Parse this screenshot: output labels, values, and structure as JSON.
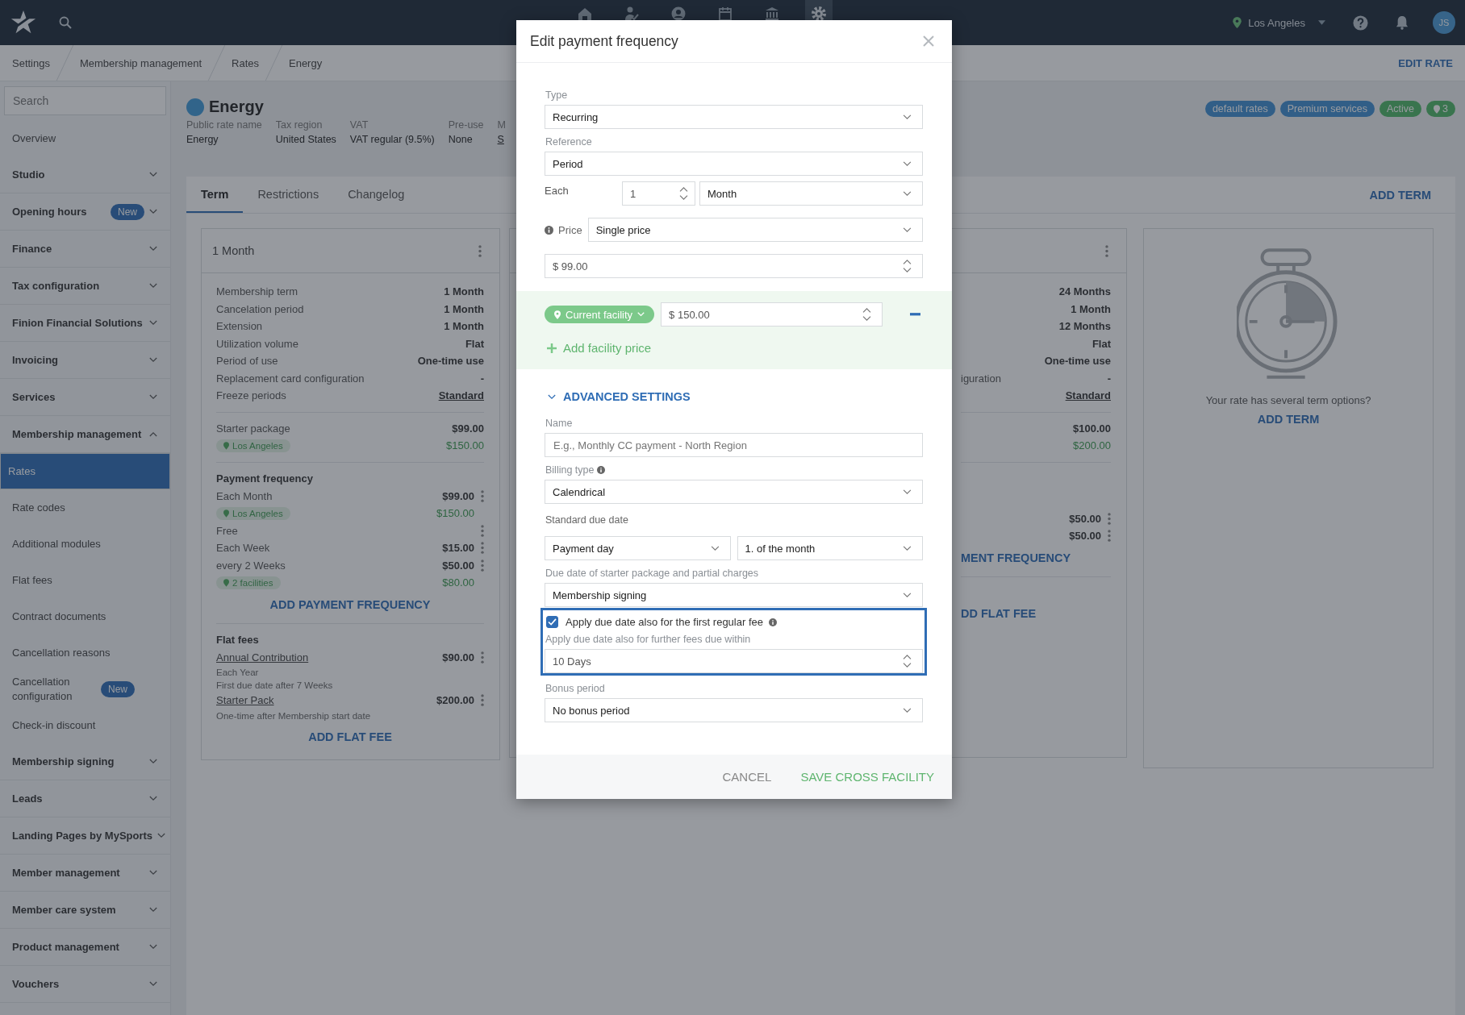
{
  "top_bar": {
    "nav": [
      {
        "kind": "home",
        "selected": false
      },
      {
        "kind": "person-check",
        "selected": false
      },
      {
        "kind": "user",
        "selected": false
      },
      {
        "kind": "calendar",
        "selected": false
      },
      {
        "kind": "bank",
        "selected": false
      },
      {
        "kind": "gear",
        "selected": true
      }
    ],
    "location": "Los Angeles",
    "user_initials": "JS"
  },
  "breadcrumbs": [
    "Settings",
    "Membership management",
    "Rates",
    "Energy"
  ],
  "header_action": "EDIT RATE",
  "sidebar": {
    "search_placeholder": "Search",
    "items": [
      {
        "label": "Overview",
        "kind": "link",
        "selected": false
      },
      {
        "label": "Studio",
        "kind": "group",
        "expanded": false
      },
      {
        "label": "Opening hours",
        "kind": "group",
        "expanded": false,
        "badge": "New"
      },
      {
        "label": "Finance",
        "kind": "group",
        "expanded": false
      },
      {
        "label": "Tax configuration",
        "kind": "group",
        "expanded": false
      },
      {
        "label": "Finion Financial Solutions",
        "kind": "group",
        "expanded": false
      },
      {
        "label": "Invoicing",
        "kind": "group",
        "expanded": false
      },
      {
        "label": "Services",
        "kind": "group",
        "expanded": false
      },
      {
        "label": "Membership management",
        "kind": "group",
        "expanded": true,
        "children": [
          {
            "label": "Rates",
            "selected": true
          },
          {
            "label": "Rate codes",
            "selected": false
          },
          {
            "label": "Additional modules",
            "selected": false
          },
          {
            "label": "Flat fees",
            "selected": false
          },
          {
            "label": "Contract documents",
            "selected": false
          },
          {
            "label": "Cancellation reasons",
            "selected": false
          },
          {
            "label": "Cancellation configuration",
            "selected": false,
            "badge": "New"
          },
          {
            "label": "Check-in discount",
            "selected": false
          }
        ]
      },
      {
        "label": "Membership signing",
        "kind": "group",
        "expanded": false
      },
      {
        "label": "Leads",
        "kind": "group",
        "expanded": false
      },
      {
        "label": "Landing Pages by MySports",
        "kind": "group",
        "expanded": false
      },
      {
        "label": "Member management",
        "kind": "group",
        "expanded": false
      },
      {
        "label": "Member care system",
        "kind": "group",
        "expanded": false
      },
      {
        "label": "Product management",
        "kind": "group",
        "expanded": false
      },
      {
        "label": "Vouchers",
        "kind": "group",
        "expanded": false
      }
    ]
  },
  "rate": {
    "name": "Energy",
    "fields": [
      {
        "label": "Public rate name",
        "value": "Energy",
        "link": false
      },
      {
        "label": "Tax region",
        "value": "United States",
        "link": false
      },
      {
        "label": "VAT",
        "value": "VAT regular (9.5%)",
        "link": false
      },
      {
        "label": "Pre-use",
        "value": "None",
        "link": false
      },
      {
        "label": "M",
        "value": "S",
        "link": true
      }
    ],
    "tags": [
      {
        "label": "default rates",
        "kind": "category"
      },
      {
        "label": "Premium services",
        "kind": "category"
      },
      {
        "label": "Active",
        "kind": "status"
      },
      {
        "label": "3",
        "kind": "location"
      }
    ]
  },
  "tabs": [
    {
      "label": "Term",
      "selected": true
    },
    {
      "label": "Restrictions",
      "selected": false
    },
    {
      "label": "Changelog",
      "selected": false
    }
  ],
  "tab_action": "ADD TERM",
  "term_card": {
    "title": "1 Month",
    "details": [
      {
        "label": "Membership term",
        "value": "1 Month",
        "link": false
      },
      {
        "label": "Cancelation period",
        "value": "1 Month",
        "link": false
      },
      {
        "label": "Extension",
        "value": "1 Month",
        "link": false
      },
      {
        "label": "Utilization volume",
        "value": "Flat",
        "link": false
      },
      {
        "label": "Period of use",
        "value": "One-time use",
        "link": false
      },
      {
        "label": "Replacement card configuration",
        "value": "-",
        "link": false
      },
      {
        "label": "Freeze periods",
        "value": "Standard",
        "link": true
      }
    ],
    "starter": {
      "label": "Starter package",
      "amount": "$99.00",
      "facility": "Los Angeles",
      "facility_amount": "$150.00"
    },
    "payment_frequency": {
      "title": "Payment frequency",
      "items": [
        {
          "label": "Each Month",
          "amount": "$99.00",
          "facility": "Los Angeles",
          "facility_amount": "$150.00"
        },
        {
          "label": "Free"
        },
        {
          "label": "Each Week",
          "amount": "$15.00"
        },
        {
          "label": "every 2 Weeks",
          "amount": "$50.00",
          "facility": "2 facilities",
          "facility_amount": "$80.00"
        }
      ],
      "action": "ADD PAYMENT FREQUENCY"
    },
    "flat_fees": {
      "title": "Flat fees",
      "items": [
        {
          "name": "Annual Contribution",
          "amount": "$90.00",
          "notes": [
            "Each Year",
            "First due date after 7 Weeks"
          ]
        },
        {
          "name": "Starter Pack",
          "amount": "$200.00",
          "notes": [
            "One-time after Membership start date"
          ]
        }
      ],
      "action": "ADD FLAT FEE"
    }
  },
  "second_card": {
    "details": [
      {
        "value": "24 Months",
        "link": false
      },
      {
        "value": "1 Month",
        "link": false
      },
      {
        "value": "12 Months",
        "link": false
      },
      {
        "value": "Flat",
        "link": false
      },
      {
        "value": "One-time use",
        "link": false
      },
      {
        "label": "iguration",
        "value": "-",
        "link": false
      },
      {
        "value": "Standard",
        "link": true
      }
    ],
    "starter_amount": "$100.00",
    "starter_facility_amount": "$200.00",
    "payment_amounts": [
      "$50.00",
      "$50.00"
    ],
    "payment_action": "MENT FREQUENCY",
    "flat_action": "DD FLAT FEE"
  },
  "empty_card": {
    "text": "Your rate has several term options?",
    "action": "ADD TERM"
  },
  "dialog": {
    "title": "Edit payment frequency",
    "type": {
      "label": "Type",
      "value": "Recurring"
    },
    "reference": {
      "label": "Reference",
      "value": "Period"
    },
    "each": {
      "label": "Each",
      "count": "1",
      "unit": "Month"
    },
    "price": {
      "label": "Price",
      "mode": "Single price",
      "amount": "$ 99.00"
    },
    "facility_prices": [
      {
        "facility": "Current facility",
        "amount": "$ 150.00"
      }
    ],
    "add_facility": "Add facility price",
    "advanced": {
      "label": "ADVANCED SETTINGS",
      "expanded": true
    },
    "name": {
      "label": "Name",
      "placeholder": "E.g., Monthly CC payment - North Region"
    },
    "billing_type": {
      "label": "Billing type",
      "value": "Calendrical"
    },
    "standard_due": {
      "label": "Standard due date",
      "day": "Payment day",
      "of_month": "1. of the month"
    },
    "starter_due": {
      "label": "Due date of starter package and partial charges",
      "value": "Membership signing"
    },
    "apply_first": {
      "label": "Apply due date also for the first regular fee",
      "checked": true
    },
    "further": {
      "label": "Apply due date also for further fees due within",
      "value": "10 Days"
    },
    "bonus": {
      "label": "Bonus period",
      "value": "No bonus period"
    },
    "buttons": [
      {
        "label": "CANCEL",
        "kind": "secondary"
      },
      {
        "label": "SAVE CROSS FACILITY",
        "kind": "primary"
      }
    ]
  }
}
